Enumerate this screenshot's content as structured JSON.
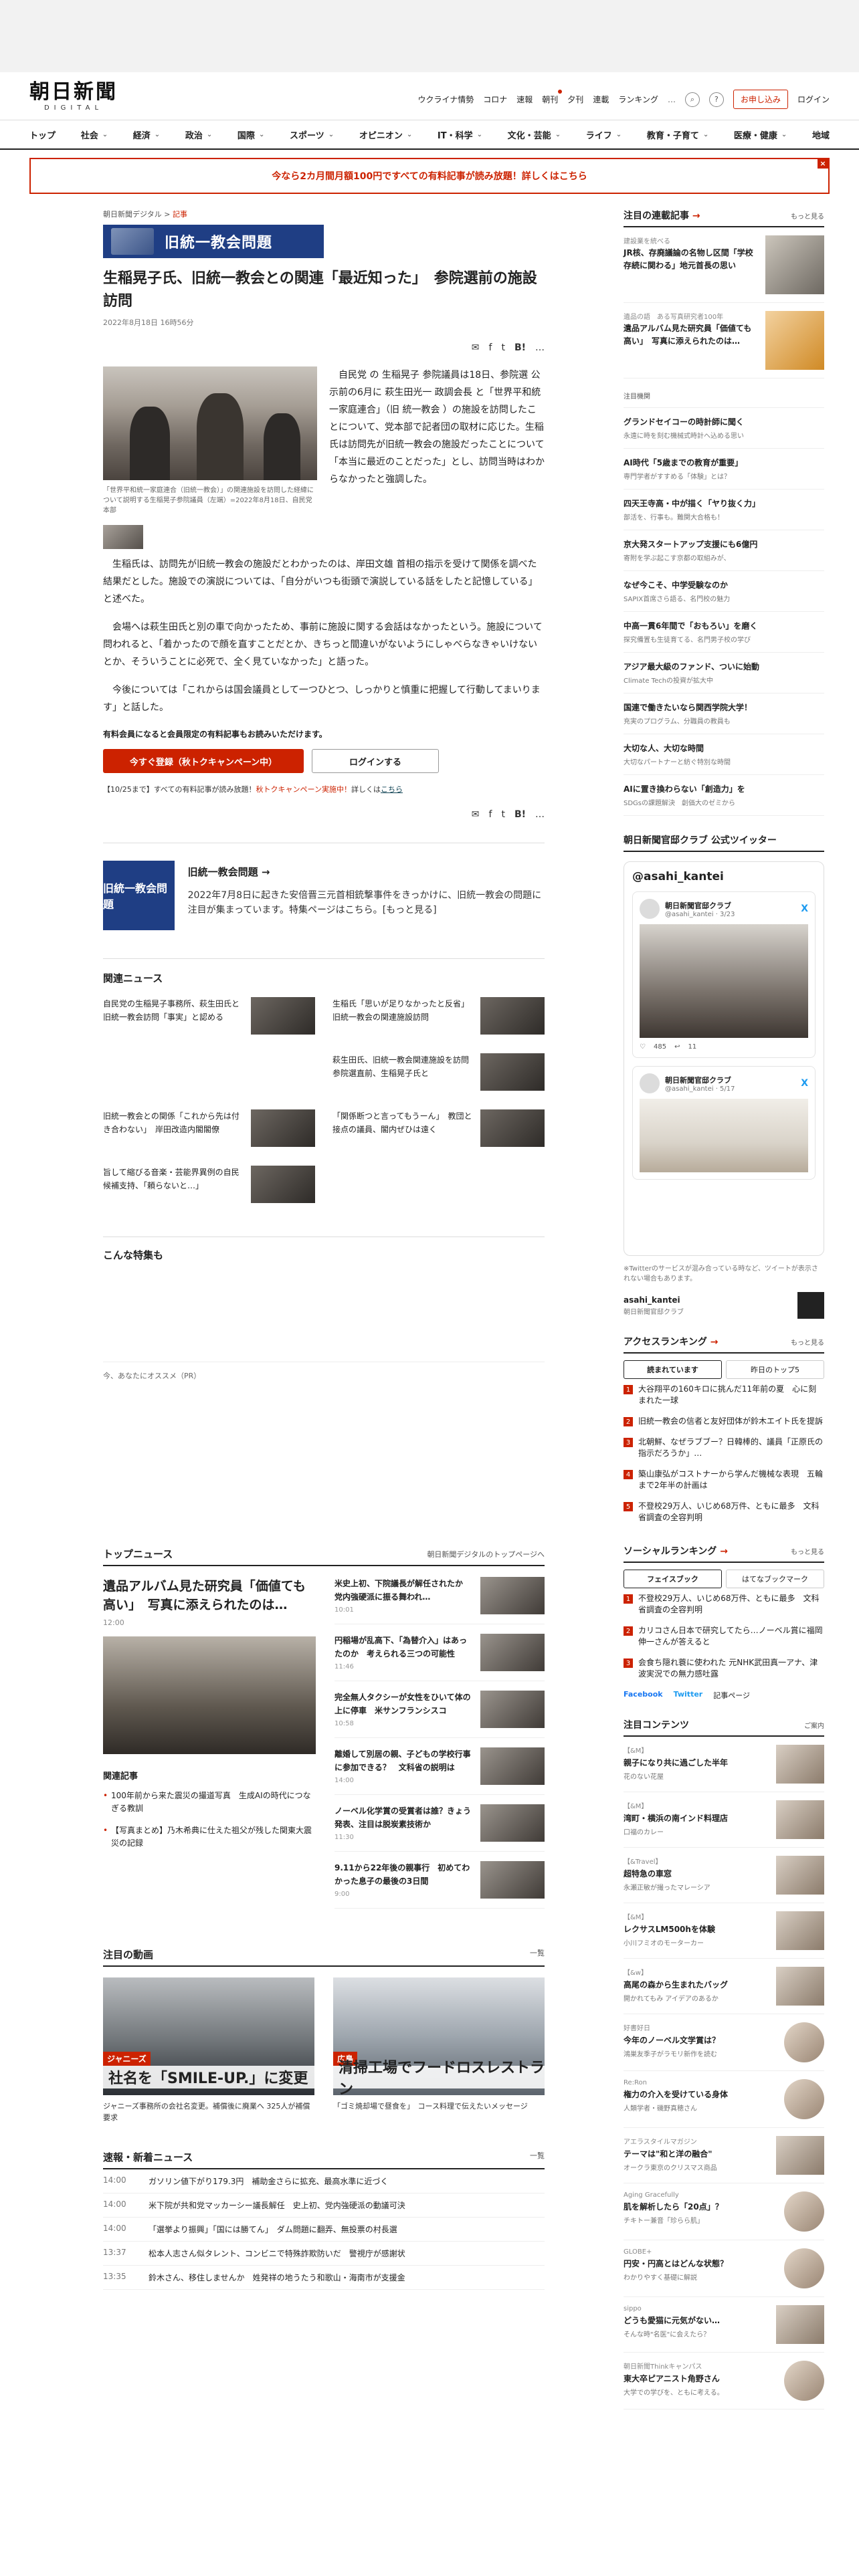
{
  "header": {
    "logo_jp": "朝日新聞",
    "logo_en": "DIGITAL",
    "util_links": [
      "ウクライナ情勢",
      "コロナ",
      "速報",
      "朝刊",
      "夕刊",
      "連載",
      "ランキング"
    ],
    "more": "…",
    "subscribe": "お申し込み",
    "login": "ログイン"
  },
  "nav": [
    "トップ",
    "社会",
    "経済",
    "政治",
    "国際",
    "スポーツ",
    "オピニオン",
    "IT・科学",
    "文化・芸能",
    "ライフ",
    "教育・子育て",
    "医療・健康",
    "地域"
  ],
  "promo": {
    "text": "今なら2カ月間月額100円ですべての有料記事が読み放題！詳しくはこちら",
    "close": "×"
  },
  "article": {
    "crumb_site": "朝日新聞デジタル",
    "crumb_sep": ">",
    "crumb_section": "記事",
    "tag": "旧統一教会問題",
    "title": "生稲晃子氏、旧統一教会との関連「最近知った」　参院選前の施設訪問",
    "date": "2022年8月18日 16時56分",
    "caption": "「世界平和統一家庭連合（旧統一教会）」の関連施設を訪問した経緯について説明する生稲晃子参院議員（左端）=2022年8月18日、自民党本部",
    "p1": "自民党 の 生稲晃子 参院議員は18日、参院選 公示前の6月に 萩生田光一 政調会長 と「世界平和統一家庭連合」（旧 統一教会 ）の施設を訪問したことについて、党本部で記者団の取材に応じた。生稲氏は訪問先が旧統一教会の施設だったことについて「本当に最近のことだった」とし、訪問当時はわからなかったと強調した。",
    "p2": "生稲氏は、訪問先が旧統一教会の施設だとわかったのは、岸田文雄 首相の指示を受けて関係を調べた結果だとした。施設での演説については、「自分がいつも街頭で演説している話をしたと記憶している」と述べた。",
    "p3": "会場へは萩生田氏と別の車で向かったため、事前に施設に関する会話はなかったという。施設について問われると、「着かったので顔を直すことだとか、きちっと間違いがないようにしゃべらなきゃいけないとか、そういうことに必死で、全く見ていなかった」と語った。",
    "p4": "今後については「これからは国会議員として一つひとつ、しっかりと慎重に把握して行動してまいります」と話した。",
    "member_note": "有料会員になると会員限定の有料記事もお読みいただけます。",
    "btn_register": "今すぐ登録（秋トクキャンペーン中）",
    "btn_login": "ログインする",
    "campaign_note_a": "【10/25まで】すべての有料記事が読み放題！",
    "campaign_note_b": "秋トクキャンペーン実施中！",
    "campaign_note_c": "詳しくは",
    "campaign_note_d": "こちら",
    "share_labels": [
      "✉",
      "f",
      "t",
      "B!",
      "…"
    ]
  },
  "series": {
    "img_label": "旧統一教会問題",
    "title": "旧統一教会問題 →",
    "desc": "2022年7月8日に起きた安倍晋三元首相銃撃事件をきっかけに、旧統一教会の問題に注目が集まっています。特集ページはこちら。",
    "more": "[もっと見る]"
  },
  "related": {
    "heading": "関連ニュース",
    "items": [
      "自民党の生稲晃子事務所、萩生田氏と旧統一教会訪問「事実」と認める",
      "生稲氏「思いが足りなかったと反省」　旧統一教会の関連施設訪問",
      "",
      "萩生田氏、旧統一教会関連施設を訪問　参院選直前、生稲晃子氏と",
      "旧統一教会との関係「これから先は付き合わない」　岸田改造内閣閣僚",
      "「関係断つと言ってもうーん」　教団と接点の議員、閣内ぜひは遠く",
      "旨して縮びる音楽・芸能界異例の自民候補支持、「頼らないと…」"
    ]
  },
  "features": {
    "heading": "こんな特集も",
    "pr": "今、あなたにオススメ（PR）"
  },
  "topnews": {
    "heading": "トップニュース",
    "more": "朝日新聞デジタルのトップページへ",
    "lead": "遺品アルバム見た研究員「価値ても高い」　写真に添えられたのは…",
    "lead_time": "12:00",
    "related_heading": "関連記事",
    "related": [
      "100年前から来た震災の撮道写真　生成AIの時代につなぎる教訓",
      "【写真まとめ】乃木希典に仕えた祖父が残した関東大震災の記録"
    ],
    "items": [
      {
        "t": "米史上初、下院議長が解任されたか　党内強硬派に振る舞われ…",
        "tm": "10:01"
      },
      {
        "t": "円稲場が乱高下、「為替介入」はあったのか　考えられる三つの可能性",
        "tm": "11:46"
      },
      {
        "t": "完全無人タクシーが女性をひいて体の上に停車　米サンフランシスコ",
        "tm": "10:58"
      },
      {
        "t": "離婚して別居の親、子どもの学校行事に参加できる？　文科省の説明は",
        "tm": "14:00"
      },
      {
        "t": "ノーベル化学賞の受賞者は誰？きょう発表、注目は脱炭素技術か",
        "tm": "11:30"
      },
      {
        "t": "9.11から22年後の親事行　初めてわかった息子の最後の3日間",
        "tm": "9:00"
      }
    ]
  },
  "videos": {
    "heading": "注目の動画",
    "more": "一覧",
    "items": [
      {
        "tag": "ジャニーズ",
        "band": "社名を「SMILE-UP.」に変更",
        "t": "ジャニーズ事務所の会社名変更。補償後に廃業へ 325人が補償要求"
      },
      {
        "tag": "広島",
        "band": "清掃工場でフードロスレストラン",
        "t": "「ゴミ焼却場で昼食を」　コース料理で伝えたいメッセージ"
      }
    ]
  },
  "flash": {
    "heading": "速報・新着ニュース",
    "more": "一覧",
    "items": [
      {
        "tm": "14:00",
        "t": "ガソリン値下がり179.3円　補助金さらに拡充、最高水準に近づく"
      },
      {
        "tm": "14:00",
        "t": "米下院が共和党マッカーシー議長解任　史上初、党内強硬派の動議可決"
      },
      {
        "tm": "14:00",
        "t": "「選挙より振興」「国には勝てん」　ダム問題に翻弄、無投票の村長選"
      },
      {
        "tm": "13:37",
        "t": "松本人志さん似タレント、コンビニで特殊詐欺防いだ　警視庁が感謝状"
      },
      {
        "tm": "13:35",
        "t": "鈴木さん、移住しませんか　姓発祥の地うたう和歌山・海南市が支援金"
      }
    ]
  },
  "sidebar": {
    "series_heading": "注目の連載記事",
    "more": "もっと見る",
    "series": [
      {
        "k": "建設業を統べる",
        "t": "JR核、存廃議論の名物し区間「学校存続に関わる」地元首長の思い",
        "img": "路線は続くか"
      },
      {
        "k": "遺品の語　ある写真研究者100年",
        "t": "遺品アルバム見た研究員「価値ても高い」　写真に添えられたのは…",
        "img": ""
      }
    ],
    "notable_tag": "注目機関",
    "notable": [
      {
        "t": "グランドセイコーの時計師に聞く",
        "sb": "永遠に時を刻む機械式時計へ込める思い"
      },
      {
        "t": "AI時代「5歳までの教育が重要」",
        "sb": "専門学者がすすめる「体験」とは？"
      },
      {
        "t": "四天王寺高・中が描く「ヤり抜く力」",
        "sb": "部活を、行事も。難関大合格も！"
      },
      {
        "t": "京大発スタートアップ支援にも6億円",
        "sb": "寄附を学ぶ起こす京都の取組みが、"
      },
      {
        "t": "なぜ今こそ、中学受験なのか",
        "sb": "SAPIX首席さら語る、名門校の魅力"
      },
      {
        "t": "中高一貫6年間で「おもろい」を磨く",
        "sb": "探究備置も生徒育てる、名門男子校の学び"
      },
      {
        "t": "アジア最大級のファンド、ついに始動",
        "sb": "Climate Techの投資が拡大中"
      },
      {
        "t": "国連で働きたいなら関西学院大学！",
        "sb": "充実のプログラム、分職員の教員も"
      },
      {
        "t": "大切な人、大切な時間",
        "sb": "大切なパートナーと紡ぐ特別な時間"
      },
      {
        "t": "AIに置き換わらない「創造力」を",
        "sb": "SDGsの課題解決　創価大のゼミから"
      }
    ],
    "twitter_heading": "朝日新聞官邸クラブ 公式ツイッター",
    "tw_handle": "@asahi_kantei",
    "tw_note": "※Twitterのサービスが混み合っている時など、ツイートが表示されない場合もあります。",
    "tw_foot_a": "asahi_kantei",
    "tw_foot_b": "朝日新聞官邸クラブ",
    "tweets": [
      {
        "nm": "朝日新聞官邸クラブ",
        "hd": "@asahi_kantei · 3/23",
        "likes": "485",
        "rt": "11"
      },
      {
        "nm": "朝日新聞官邸クラブ",
        "hd": "@asahi_kantei · 5/17",
        "likes": "",
        "rt": ""
      }
    ],
    "access_heading": "アクセスランキング",
    "access_tabs": [
      "読まれています",
      "昨日のトップ5"
    ],
    "access": [
      "大谷翔平の160キロに挑んだ11年前の夏　心に刻まれた一球",
      "旧統一教会の信者と友好団体が鈴木エイト氏を提訴",
      "北朝鮮、なぜラブブー？日韓棒的、議員「正原氏の指示だろうか」…",
      "築山康弘がコストナーから学んだ機械な表現　五輪まで2年半の計画は",
      "不登校29万人、いじめ68万件、ともに最多　文科省調査の全容判明"
    ],
    "social_heading": "ソーシャルランキング",
    "social_tabs": [
      "フェイスブック",
      "はてなブックマーク"
    ],
    "social": [
      "不登校29万人、いじめ68万件、ともに最多　文科省調査の全容判明",
      "カリコさん日本で研究してたら…ノーベル賞に福岡伸一さんが答えると",
      "会食ち隠れ蓑に使われた 元NHK武田真一アナ、津波実況での無力感吐露"
    ],
    "social_share": [
      "Facebook",
      "Twitter",
      "記事ページ"
    ],
    "contents_heading": "注目コンテンツ",
    "contents_more": "ご案内",
    "contents": [
      {
        "k": "【&M】",
        "t": "親子になり共に過ごした半年",
        "sb": "花のない花屋"
      },
      {
        "k": "【&M】",
        "t": "湾町・横浜の南インド料理店",
        "sb": "口福のカレー"
      },
      {
        "k": "【&Travel】",
        "t": "超特急の車窓",
        "sb": "永瀬正敏が撮ったマレーシア"
      },
      {
        "k": "【&M】",
        "t": "レクサスLM500hを体験",
        "sb": "小川フミオのモーターカー"
      },
      {
        "k": "【&w】",
        "t": "高尾の森から生まれたバッグ",
        "sb": "開かれてもみ アイデアのあるか"
      },
      {
        "k": "好書好日",
        "t": "今年のノーベル文学賞は？",
        "sb": "鴻巣友季子がラモリ新作を読む"
      },
      {
        "k": "Re:Ron",
        "t": "権力の介入を受けている身体",
        "sb": "人類学者・磯野真穂さん"
      },
      {
        "k": "アエラスタイルマガジン",
        "t": "テーマは\"和と洋の融合\"",
        "sb": "オークラ東京のクリスマス商品"
      },
      {
        "k": "Aging Gracefully",
        "t": "肌を解析したら「20点」？",
        "sb": "チキトー兼音「珍らら肌」"
      },
      {
        "k": "GLOBE+",
        "t": "円安・円高とはどんな状態？",
        "sb": "わかりやすく基礎に解説"
      },
      {
        "k": "sippo",
        "t": "どうも愛猫に元気がない…",
        "sb": "そんな時\"名医\"に会えたら？"
      },
      {
        "k": "朝日新聞Thinkキャンパス",
        "t": "東大卒ピアニスト角野さん",
        "sb": "大学での学びを、ともに考える。"
      }
    ]
  }
}
